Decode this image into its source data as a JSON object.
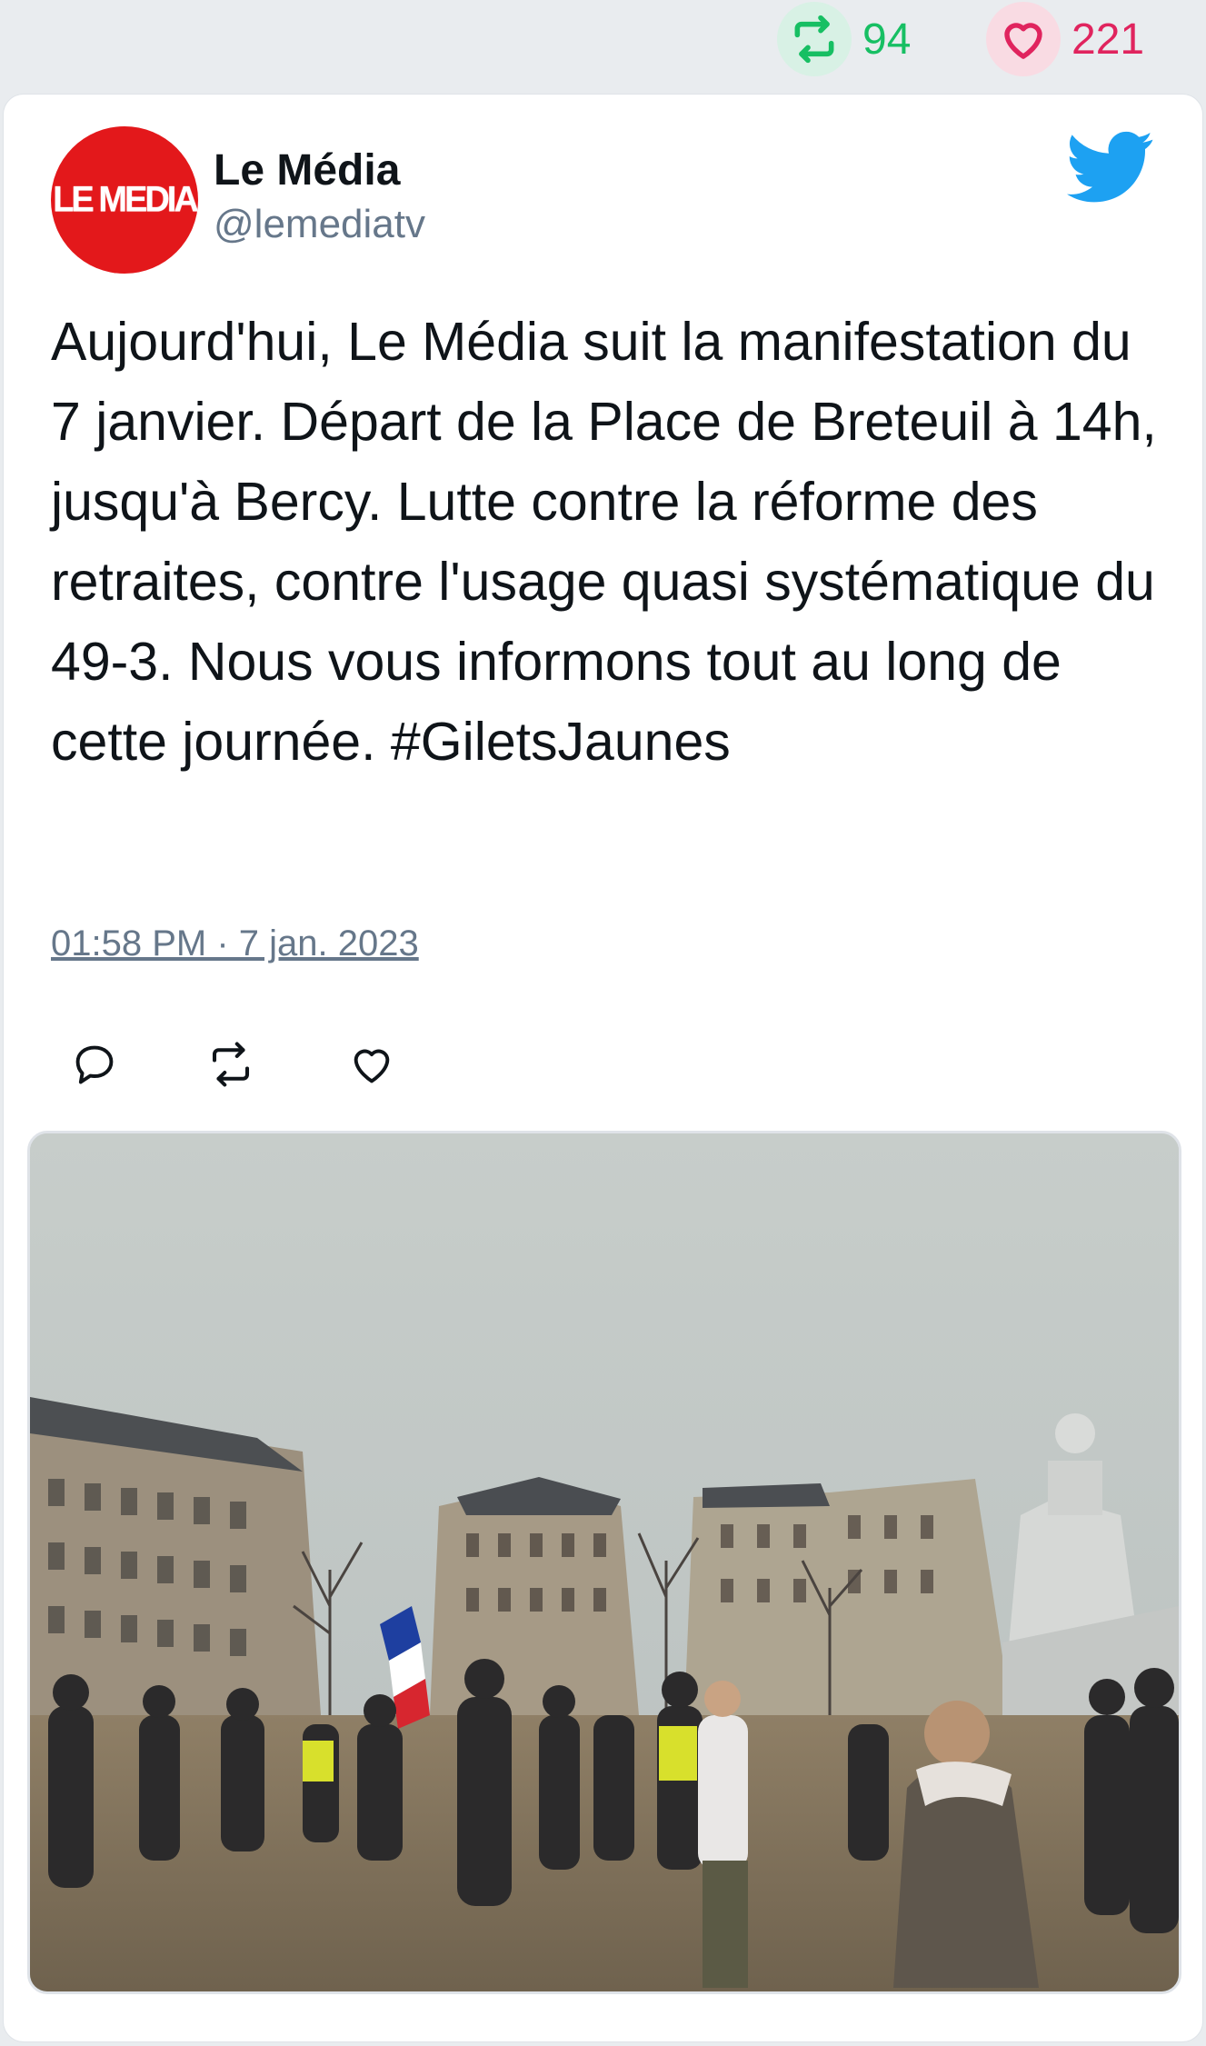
{
  "stats": {
    "retweet_count": "94",
    "like_count": "221",
    "retweet_icon": "retweet-icon",
    "like_icon": "heart-icon"
  },
  "author": {
    "name": "Le Média",
    "handle": "@lemediatv",
    "avatar_logo_text": "LEMEDIA",
    "avatar_color": "#e3181b"
  },
  "tweet": {
    "text": "Aujourd'hui, Le Média suit la manifestation du 7 janvier. Départ de la Place de Breteuil à 14h, jusqu'à Bercy. Lutte contre la réforme des retraites, contre l'usage quasi systématique du 49-3. Nous vous informons tout au long de cette journée. #GiletsJaunes",
    "timestamp": "01:58 PM · 7 jan. 2023"
  },
  "actions": [
    {
      "name": "reply",
      "icon": "reply-icon"
    },
    {
      "name": "retweet",
      "icon": "retweet-icon"
    },
    {
      "name": "like",
      "icon": "heart-icon"
    }
  ],
  "colors": {
    "background": "#e9ecef",
    "retweet_green": "#17bf63",
    "like_red": "#e0245e",
    "twitter_blue": "#1da1f2",
    "muted_text": "#66778a"
  }
}
